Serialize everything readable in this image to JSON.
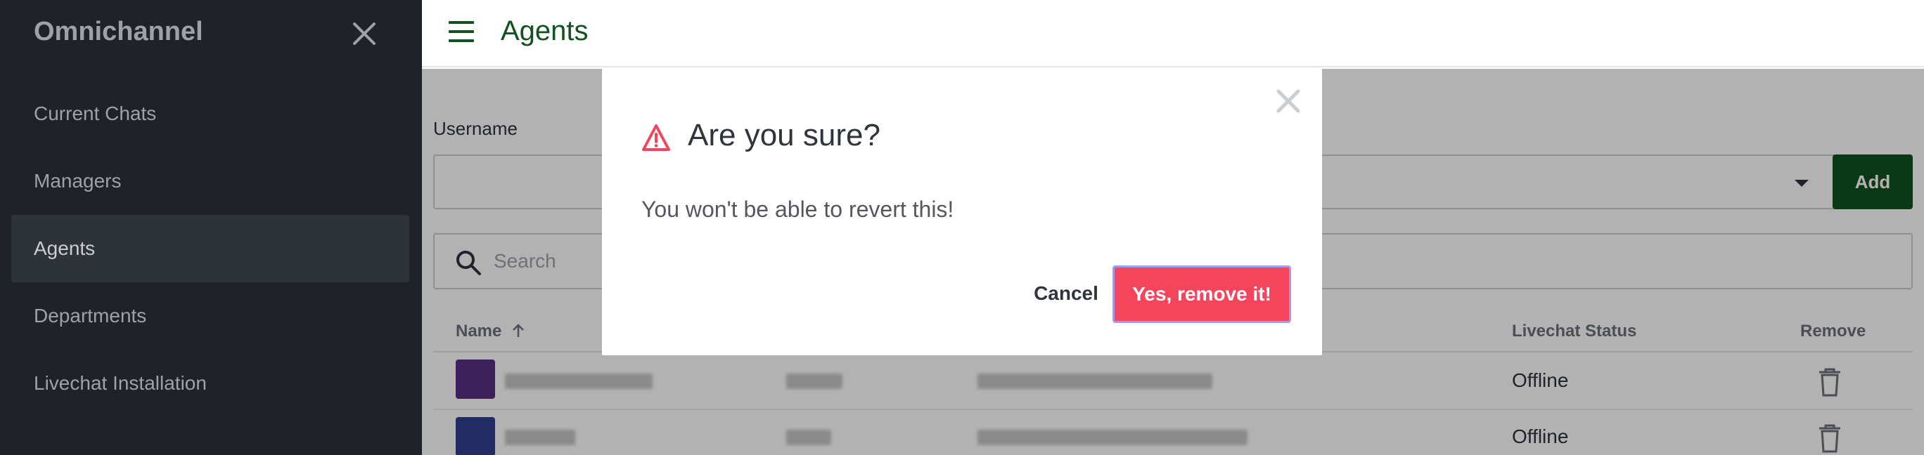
{
  "sidebar": {
    "title": "Omnichannel",
    "close_icon": "close-icon",
    "items": [
      {
        "label": "Current Chats",
        "active": false
      },
      {
        "label": "Managers",
        "active": false
      },
      {
        "label": "Agents",
        "active": true
      },
      {
        "label": "Departments",
        "active": false
      },
      {
        "label": "Livechat Installation",
        "active": false
      }
    ]
  },
  "header": {
    "menu_icon": "hamburger-icon",
    "title": "Agents"
  },
  "form": {
    "username_label": "Username",
    "add_label": "Add",
    "search_placeholder": "Search"
  },
  "table": {
    "columns": {
      "name": "Name",
      "status": "Livechat Status",
      "remove": "Remove"
    },
    "sort_icon": "arrow-up-icon",
    "rows": [
      {
        "status": "Offline",
        "avatar_color": "#5a2e86"
      },
      {
        "status": "Offline",
        "avatar_color": "#2f3f8f"
      }
    ]
  },
  "modal": {
    "icon": "warning-icon",
    "title": "Are you sure?",
    "text": "You won't be able to revert this!",
    "cancel_label": "Cancel",
    "confirm_label": "Yes, remove it!"
  },
  "colors": {
    "sidebar_bg": "#1f2329",
    "accent": "#12521f",
    "danger": "#f5455c",
    "focus_ring": "#a79be6"
  }
}
